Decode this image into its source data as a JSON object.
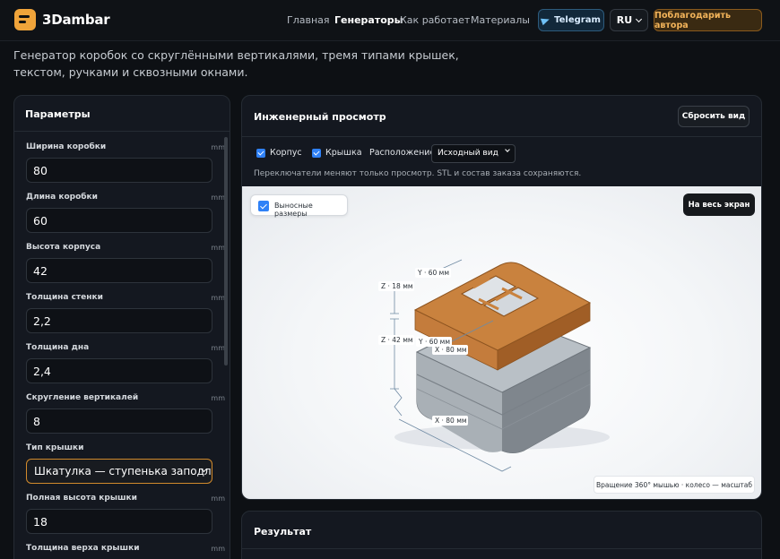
{
  "header": {
    "brand": "3Dambar",
    "nav": [
      "Главная",
      "Генераторы",
      "Как работает",
      "Материалы"
    ],
    "telegram": "Telegram",
    "lang": "RU",
    "thanks": "Поблагодарить автора"
  },
  "intro": "Генератор коробок со скруглёнными вертикалями, тремя типами крышек, текстом, ручками и сквозными окнами.",
  "params": {
    "title": "Параметры",
    "fields": [
      {
        "label": "Ширина коробки",
        "unit": "mm",
        "value": "80"
      },
      {
        "label": "Длина коробки",
        "unit": "mm",
        "value": "60"
      },
      {
        "label": "Высота корпуса",
        "unit": "mm",
        "value": "42"
      },
      {
        "label": "Толщина стенки",
        "unit": "mm",
        "value": "2,2"
      },
      {
        "label": "Толщина дна",
        "unit": "mm",
        "value": "2,4"
      },
      {
        "label": "Скругление вертикалей",
        "unit": "mm",
        "value": "8"
      },
      {
        "label": "Тип крышки",
        "value": "Шкатулка — ступенька заподлицо"
      },
      {
        "label": "Полная высота крышки",
        "unit": "mm",
        "value": "18"
      },
      {
        "label": "Толщина верха крышки",
        "unit": "mm",
        "value": ""
      }
    ]
  },
  "viewer": {
    "title": "Инженерный просмотр",
    "reset": "Сбросить вид",
    "cb_body": "Корпус",
    "cb_lid": "Крышка",
    "position_label": "Расположение",
    "position_value": "Исходный вид",
    "hint": "Переключатели меняют только просмотр. STL и состав заказа сохраняются.",
    "dims_toggle": "Выносные размеры",
    "fullscreen": "На весь экран",
    "caption": "Вращение 360° мышью · колесо — масштаб",
    "dims": {
      "y_top": "Y · 60 мм",
      "z_lid": "Z · 18 мм",
      "z_body": "Z · 42 мм",
      "y_mid": "Y · 60 мм",
      "x_mid": "X · 80 мм",
      "x_bottom": "X · 80 мм"
    },
    "colors": {
      "lid": "#c47c3c",
      "body": "#8e959c"
    }
  },
  "result": {
    "title": "Результат"
  }
}
